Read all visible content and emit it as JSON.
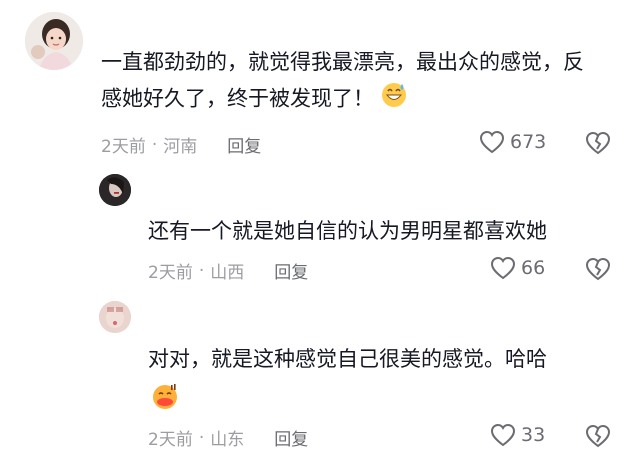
{
  "comments": [
    {
      "text": "一直都劲劲的，就觉得我最漂亮，最出众的感觉，反感她好久了，终于被发现了！",
      "emoji": "grinning-sweat-emoji",
      "time": "2天前",
      "location": "河南",
      "reply_label": "回复",
      "likes": "673"
    },
    {
      "text": "还有一个就是她自信的认为男明星都喜欢她",
      "time": "2天前",
      "location": "山西",
      "reply_label": "回复",
      "likes": "66"
    },
    {
      "text": "对对，就是这种感觉自己很美的感觉。哈哈",
      "emoji": "kissing-sweat-emoji",
      "time": "2天前",
      "location": "山东",
      "reply_label": "回复",
      "likes": "33"
    }
  ],
  "separator": "·",
  "icons": {
    "like": "heart-icon",
    "dislike": "broken-heart-icon"
  },
  "colors": {
    "text": "#161823",
    "meta": "#9c9da2",
    "icon": "#6b6c72"
  }
}
